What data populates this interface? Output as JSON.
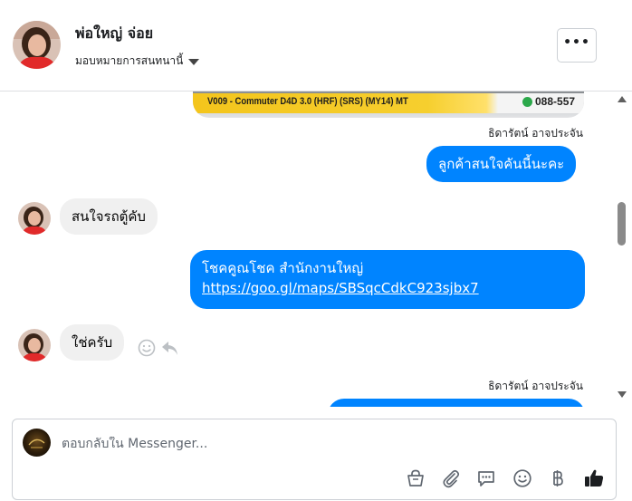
{
  "header": {
    "contact_name": "พ่อใหญ่ จ่อย",
    "assign_label": "มอบหมายการสนทนานี้",
    "more_label": "•••"
  },
  "thread": {
    "product_image": {
      "caption": "V009 - Commuter D4D 3.0 (HRF) (SRS) (MY14) MT",
      "phone": "088-557"
    },
    "messages": [
      {
        "direction": "out",
        "sender": "ธิดารัตน์ อาจประจัน",
        "text": "ลูกค้าสนใจคันนี้นะคะ"
      },
      {
        "direction": "in",
        "text": "สนใจรถตู้คับ"
      },
      {
        "direction": "out",
        "text_line1": "โชคคูณโชค สำนักงานใหญ่",
        "link": "https://goo.gl/maps/SBSqcCdkC923sjbx7"
      },
      {
        "direction": "in",
        "text": "ใช่ครับ"
      },
      {
        "direction": "out",
        "sender": "ธิดารัตน์ อาจประจัน"
      }
    ]
  },
  "composer": {
    "placeholder": "ตอบกลับใน Messenger...",
    "tools": [
      "bag-icon",
      "attachment-icon",
      "saved-replies-icon",
      "emoji-icon",
      "baht-icon",
      "thumbs-up-icon"
    ],
    "accent": "#0084ff"
  }
}
